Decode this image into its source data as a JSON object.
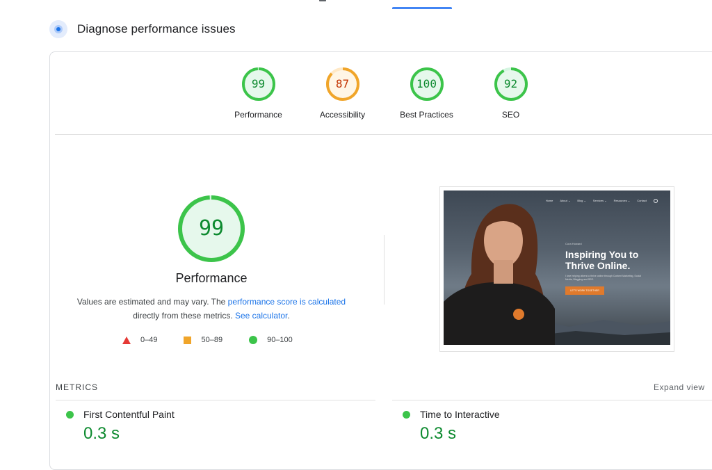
{
  "heading": {
    "title": "Diagnose performance issues",
    "icon": "lighthouse-icon"
  },
  "gauges": [
    {
      "label": "Performance",
      "score": "99",
      "value": 99,
      "status": "pass"
    },
    {
      "label": "Accessibility",
      "score": "87",
      "value": 87,
      "status": "average"
    },
    {
      "label": "Best Practices",
      "score": "100",
      "value": 100,
      "status": "pass"
    },
    {
      "label": "SEO",
      "score": "92",
      "value": 92,
      "status": "pass"
    }
  ],
  "main_gauge": {
    "score": "99",
    "value": 99,
    "title": "Performance",
    "desc_1": "Values are estimated and may vary. The ",
    "desc_link_1": "performance score is calculated",
    "desc_2": "directly from these metrics. ",
    "desc_link_2": "See calculator",
    "desc_3": "."
  },
  "legend": [
    {
      "shape": "triangle",
      "range": "0–49",
      "color": "#e53935"
    },
    {
      "shape": "square",
      "range": "50–89",
      "color": "#f0a52a"
    },
    {
      "shape": "circle",
      "range": "90–100",
      "color": "#3cc44a"
    }
  ],
  "screenshot": {
    "nav": [
      "Home",
      "About ⌄",
      "Blog ⌄",
      "Services ⌄",
      "Resources ⌄",
      "Contact"
    ],
    "eyebrow": "Cora Howard",
    "headline_1": "Inspiring You to",
    "headline_2": "Thrive Online.",
    "subtext": "I love helping others to thrive online through Content Marketing, Social Media, Blogging and SEO.",
    "button": "LET'S WORK TOGETHER"
  },
  "metrics": {
    "label": "METRICS",
    "expand": "Expand view",
    "items": [
      {
        "name": "First Contentful Paint",
        "value": "0.3 s"
      },
      {
        "name": "Time to Interactive",
        "value": "0.3 s"
      }
    ]
  },
  "colors": {
    "pass": "#0cce6b",
    "pass_text": "#0d8a2f",
    "average": "#ffa400",
    "average_text": "#c33300",
    "link": "#1a73e8"
  }
}
